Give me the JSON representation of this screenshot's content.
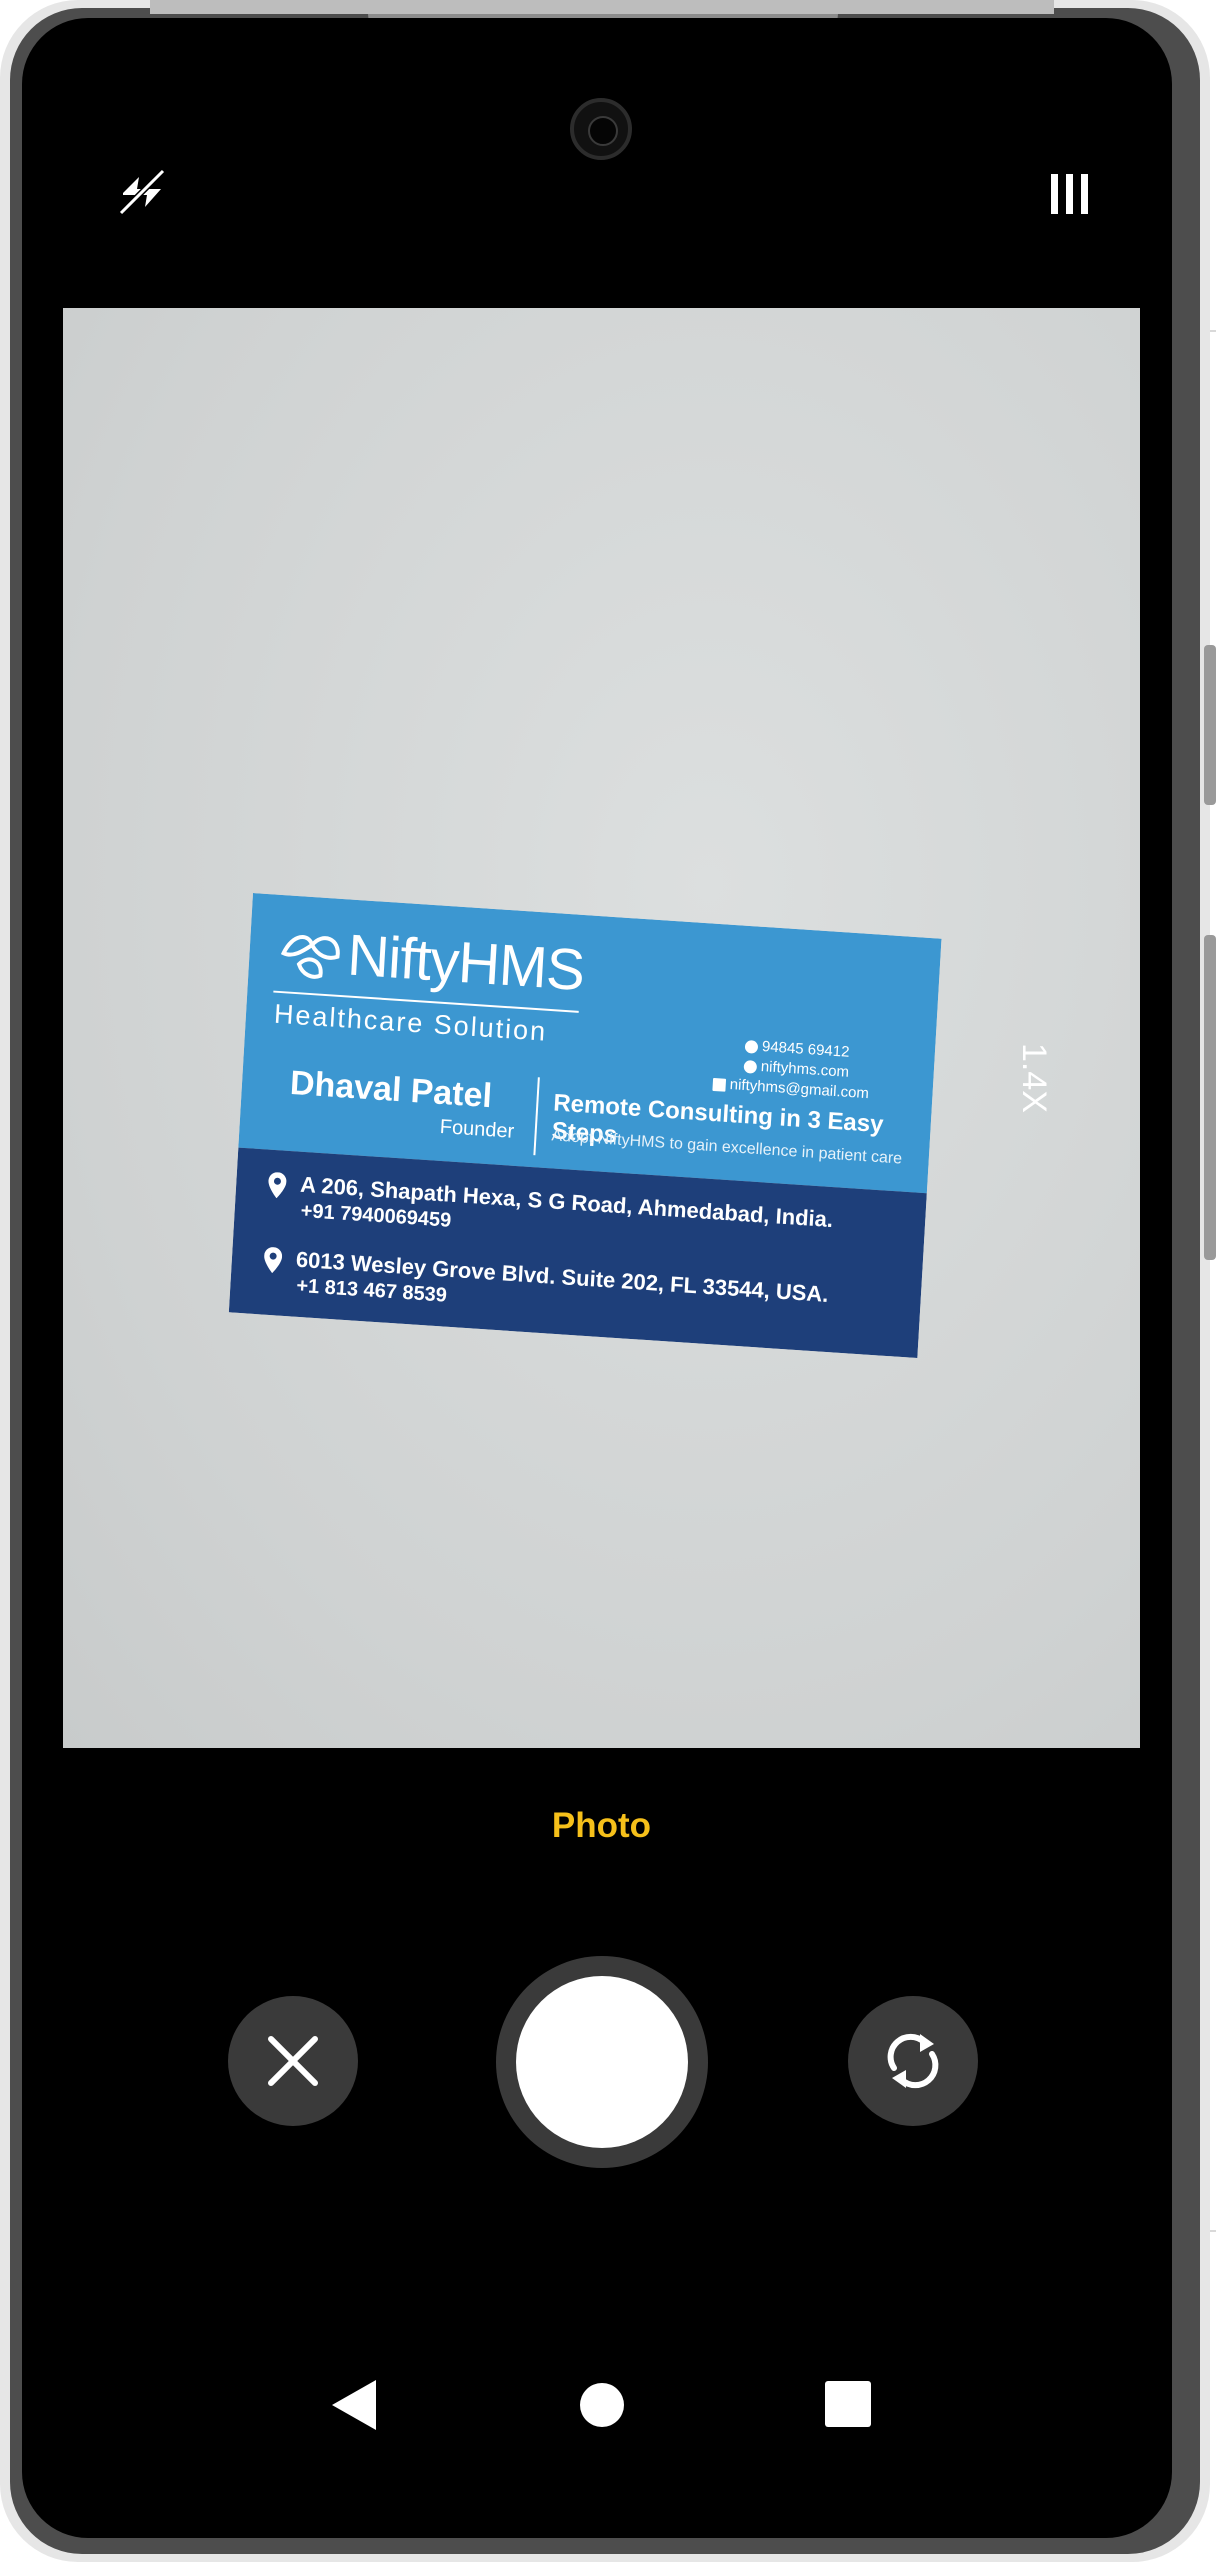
{
  "camera": {
    "zoom": "1.4X",
    "mode": "Photo"
  },
  "icons": {
    "flash": "flash-off-icon",
    "grid": "grid-icon",
    "cancel": "close-icon",
    "switch": "switch-camera-icon",
    "shutter": "shutter-button"
  },
  "colors": {
    "mode_accent": "#f6c01a",
    "card_blue": "#3c97d1",
    "card_navy": "#1e3f7a"
  },
  "business_card": {
    "brand": "NiftyHMS",
    "tagline": "Healthcare Solution",
    "name": "Dhaval Patel",
    "role": "Founder",
    "slogan": "Remote Consulting in 3 Easy Steps",
    "subline": "Adopt NiftyHMS to gain excellence in patient care",
    "phone": "94845 69412",
    "website": "niftyhms.com",
    "email": "niftyhms@gmail.com",
    "address1_line1": "A 206, Shapath Hexa, S G Road, Ahmedabad, India.",
    "address1_line2": "+91 7940069459",
    "address2_line1": "6013 Wesley Grove Blvd. Suite 202, FL 33544, USA.",
    "address2_line2": "+1 813 467 8539"
  }
}
